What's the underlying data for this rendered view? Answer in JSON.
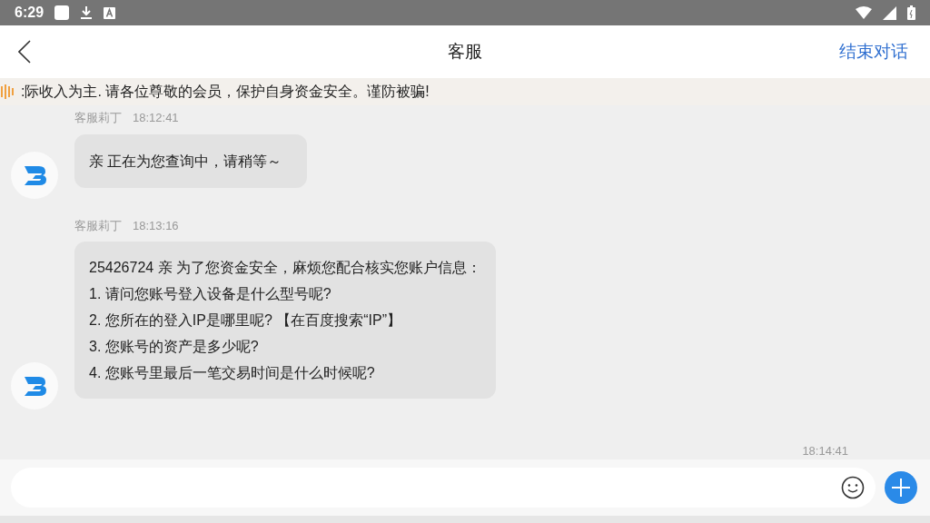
{
  "status_bar": {
    "time": "6:29"
  },
  "header": {
    "title": "客服",
    "action": "结束对话"
  },
  "notice": {
    "text": ":际收入为主. 请各位尊敬的会员，保护自身资金安全。谨防被骗!"
  },
  "messages": [
    {
      "sender": "客服莉丁",
      "time": "18:12:41",
      "lines": [
        "亲 正在为您查询中，请稍等～"
      ]
    },
    {
      "sender": "客服莉丁",
      "time": "18:13:16",
      "lines": [
        "25426724  亲 为了您资金安全，麻烦您配合核实您账户信息：",
        "1. 请问您账号登入设备是什么型号呢?",
        "2. 您所在的登入IP是哪里呢? 【在百度搜索“IP”】",
        "3. 您账号的资产是多少呢?",
        "4. 您账号里最后一笔交易时间是什么时候呢?"
      ]
    }
  ],
  "last_time": "18:14:41"
}
